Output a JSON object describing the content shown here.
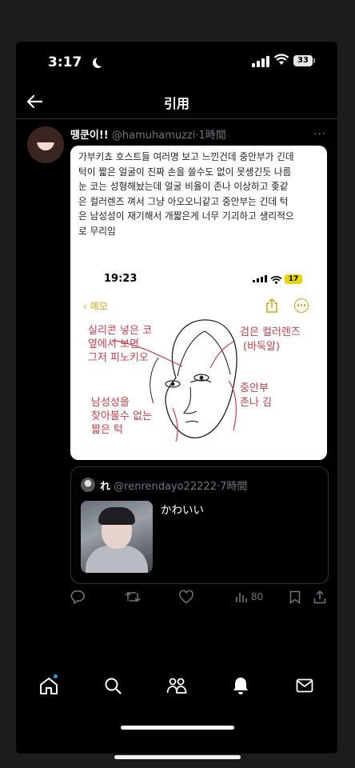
{
  "status_bar": {
    "time": "3:17",
    "battery": "33"
  },
  "header": {
    "title": "引用"
  },
  "post": {
    "display_name": "땡쿤이!!",
    "handle": "@hamuhamuzzi",
    "dot": "·",
    "time": "1時間",
    "more": "···",
    "text_lines": [
      "가부키쵸 호스트들 여러명 보고 느낀건데 중안부가 긴데",
      "턱이 짧은 얼굴이 진짜 손을 쓸수도 없이 못생긴듯 나름",
      "눈 코는 성형해놨는데 얼굴 비율이 존나 이상하고 좆같",
      "은 컬러렌즈 껴서 그냥 아오오니같고 중안부는 긴데 턱",
      "은 남성성이 재기해서 개짧은게 너무 기괴하고 생리적으",
      "로 무리임"
    ]
  },
  "embedded_memo": {
    "time": "19:23",
    "battery": "17",
    "back_label": "메모",
    "notes": {
      "left_top": [
        "실리콘 넣은 코",
        "옆에서 보면",
        "그저 피노키오"
      ],
      "left_bottom": [
        "남성성을",
        "찾아볼수 없는",
        "짧은 턱"
      ],
      "right_top": [
        "검은 컬러렌즈",
        "(바둑알)"
      ],
      "right_bottom": [
        "중안부",
        "존나 김"
      ]
    }
  },
  "quote": {
    "display_name": "れ",
    "handle": "@renrendayo22222",
    "dot": "·",
    "time": "7時間",
    "text": "かわいい"
  },
  "actions": {
    "views": "80"
  },
  "colors": {
    "accent": "#1d9bf0",
    "memo_yellow": "#d4a017",
    "ink_red": "#c0404b"
  }
}
